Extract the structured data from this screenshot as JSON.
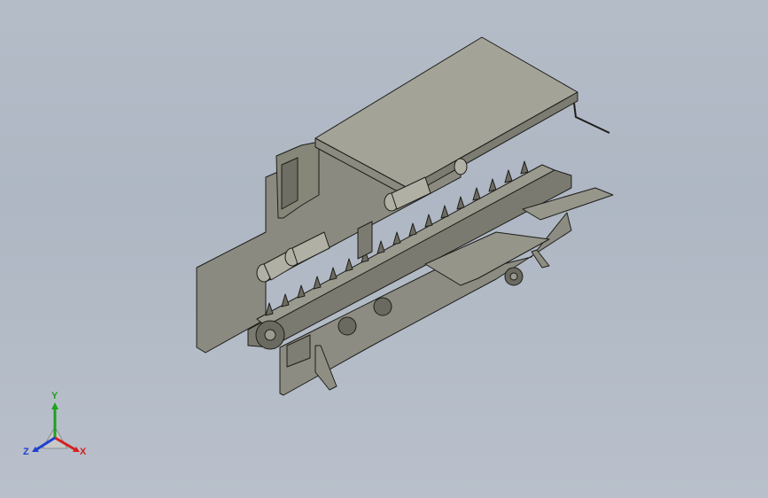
{
  "viewport": {
    "background_top": "#b4bcc8",
    "background_bottom": "#b9c0cb"
  },
  "model": {
    "part_color": "#8a8a80",
    "top_color": "#a3a398",
    "edge_color": "#1e1e1a"
  },
  "triad": {
    "x_label": "X",
    "y_label": "Y",
    "z_label": "Z",
    "x_color": "#d42020",
    "y_color": "#20a020",
    "z_color": "#2040d0"
  }
}
